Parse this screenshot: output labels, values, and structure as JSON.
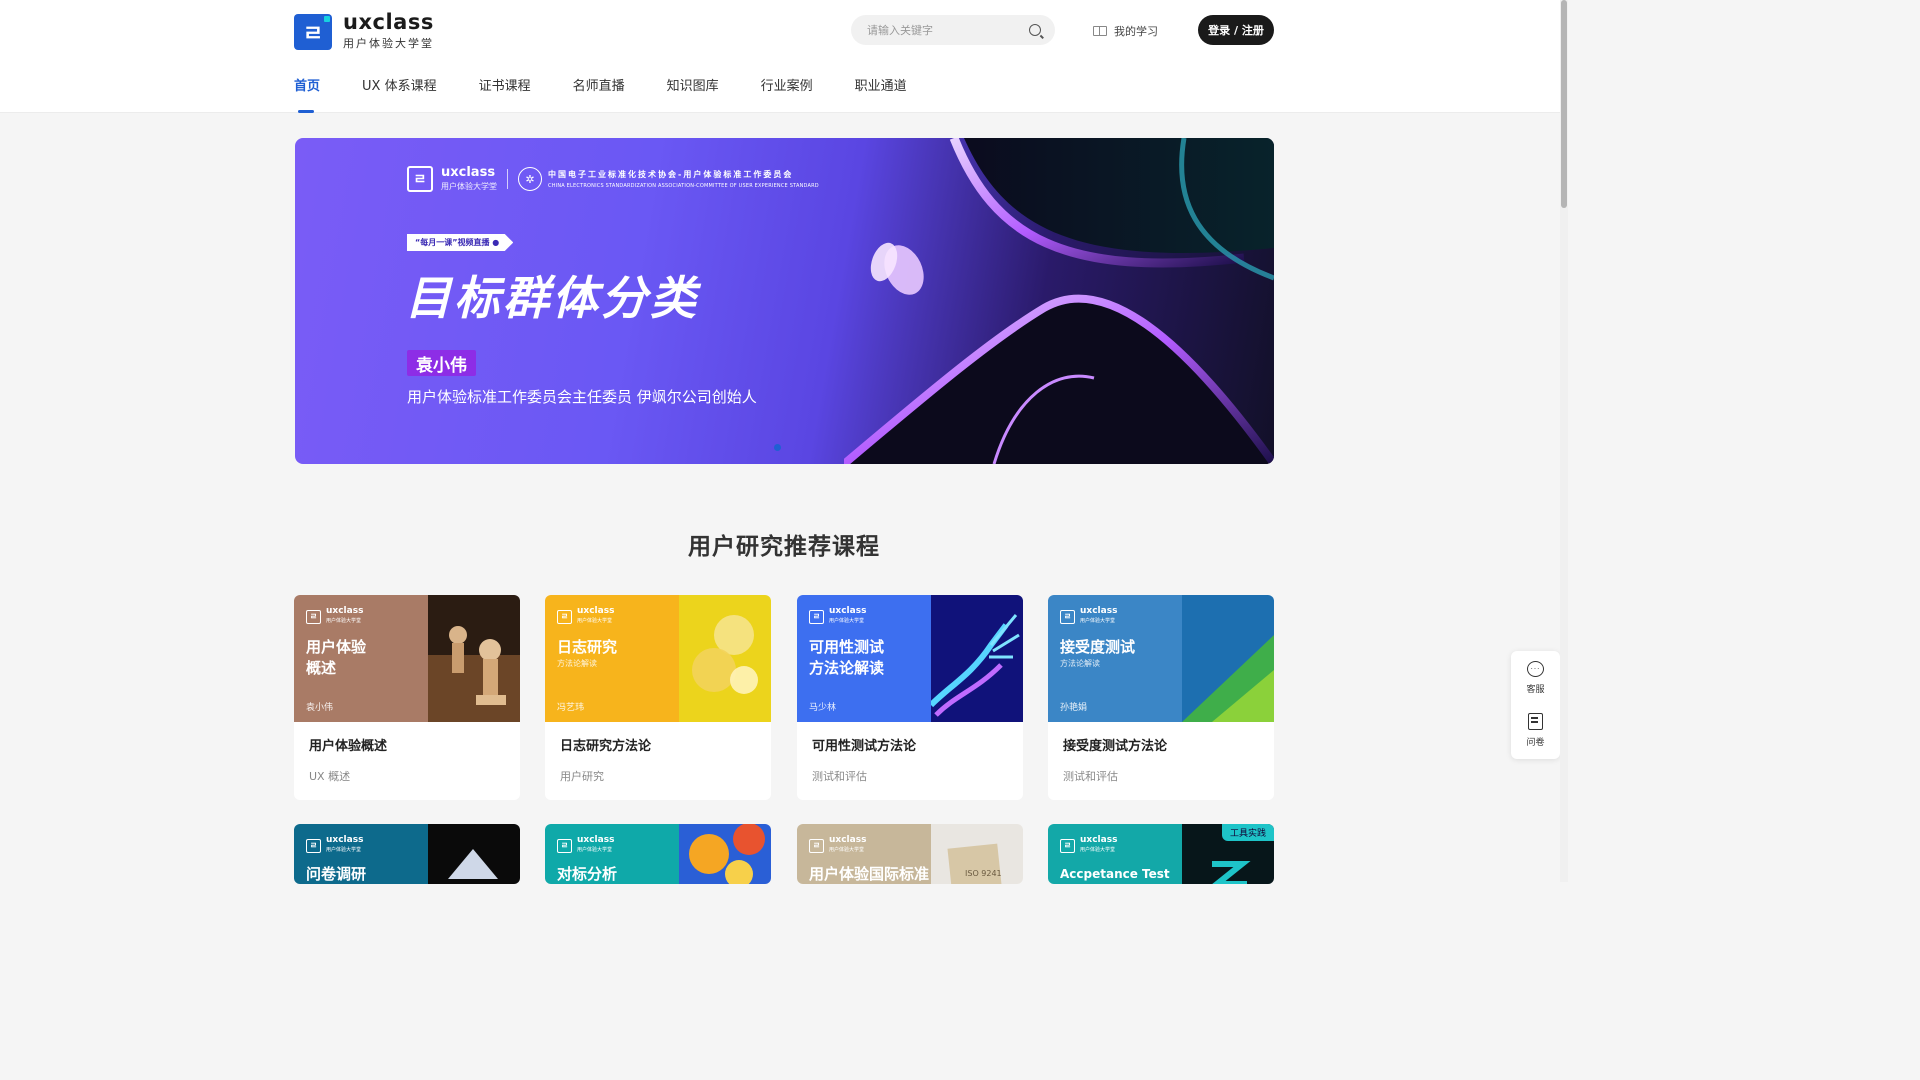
{
  "header": {
    "logo_name": "uxclass",
    "logo_sub": "用户体验大学堂",
    "search_placeholder": "请输入关键字",
    "my_study": "我的学习",
    "login": "登录 / 注册"
  },
  "nav": [
    {
      "label": "首页",
      "active": true
    },
    {
      "label": "UX 体系课程"
    },
    {
      "label": "证书课程"
    },
    {
      "label": "名师直播"
    },
    {
      "label": "知识图库"
    },
    {
      "label": "行业案例"
    },
    {
      "label": "职业通道"
    }
  ],
  "banner": {
    "logo_name": "uxclass",
    "logo_sub": "用户体验大学堂",
    "org_cn": "中国电子工业标准化技术协会-用户体验标准工作委员会",
    "org_en": "CHINA ELECTRONICS STANDARDIZATION ASSOCIATION-COMMITTEE OF USER EXPERIENCE STANDARD",
    "tag": "“每月一课”视频直播 ●",
    "title": "目标群体分类",
    "speaker": "袁小伟",
    "role": "用户体验标准工作委员会主任委员    伊飒尔公司创始人",
    "accent": "#6a58f4"
  },
  "section": {
    "title": "用户研究推荐课程"
  },
  "cards": [
    {
      "cover_title": "用户体验\n概述",
      "cover_sub": "",
      "author": "袁小伟",
      "name": "用户体验概述",
      "tag": "UX 概述",
      "color": "#a97b66",
      "art": "chess-icon"
    },
    {
      "cover_title": "日志研究",
      "cover_sub": "方法论解读",
      "author": "冯艺玮",
      "name": "日志研究方法论",
      "tag": "用户研究",
      "color": "#f7b41c",
      "art": "bubbles-icon"
    },
    {
      "cover_title": "可用性测试\n方法论解读",
      "cover_sub": "",
      "author": "马少林",
      "name": "可用性测试方法论",
      "tag": "测试和评估",
      "color": "#3d6ff0",
      "art": "robot-hand-icon"
    },
    {
      "cover_title": "接受度测试",
      "cover_sub": "方法论解读",
      "author": "孙艳娟",
      "name": "接受度测试方法论",
      "tag": "测试和评估",
      "color": "#3b86c6",
      "art": "texture-icon"
    },
    {
      "cover_title": "问卷调研",
      "color": "#0d6a8c",
      "art": "crystal-icon"
    },
    {
      "cover_title": "对标分析",
      "color": "#0fa9a9",
      "art": "flower-icon"
    },
    {
      "cover_title": "用户体验国际标准",
      "color": "#c7b79a",
      "art": "document-icon",
      "art_text": "ISO 9241"
    },
    {
      "cover_title": "Accpetance Test",
      "color": "#13a8a8",
      "art": "logo-art-icon",
      "corner": "工具实践"
    }
  ],
  "cover_logo": {
    "name": "uxclass",
    "sub": "用户体验大学堂"
  },
  "float_panel": {
    "service": "客服",
    "survey": "问卷"
  }
}
